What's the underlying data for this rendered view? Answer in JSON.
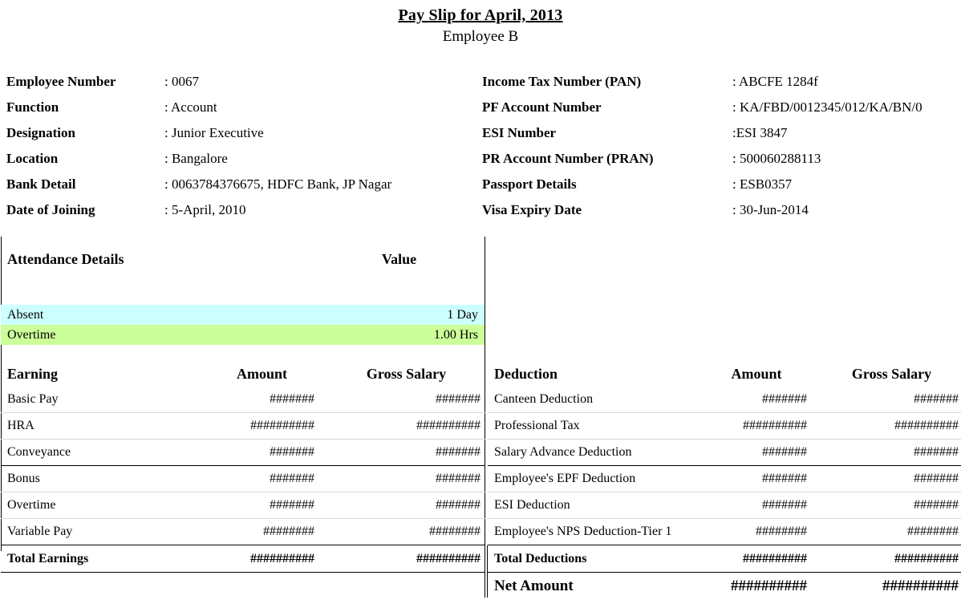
{
  "header": {
    "title": "Pay Slip for April, 2013",
    "subtitle": "Employee B"
  },
  "employee_info": {
    "left": [
      {
        "label": "Employee Number",
        "value": ": 0067"
      },
      {
        "label": "Function",
        "value": ": Account"
      },
      {
        "label": "Designation",
        "value": ": Junior Executive"
      },
      {
        "label": "Location",
        "value": ": Bangalore"
      },
      {
        "label": "Bank Detail",
        "value": ": 0063784376675, HDFC Bank, JP Nagar"
      },
      {
        "label": "Date of Joining",
        "value": ": 5-April, 2010"
      }
    ],
    "right": [
      {
        "label": "Income Tax Number (PAN)",
        "value": ": ABCFE 1284f"
      },
      {
        "label": "PF Account Number",
        "value": ": KA/FBD/0012345/012/KA/BN/0"
      },
      {
        "label": "ESI Number",
        "value": ":ESI 3847"
      },
      {
        "label": "PR Account Number (PRAN)",
        "value": ": 500060288113"
      },
      {
        "label": "Passport Details",
        "value": ": ESB0357"
      },
      {
        "label": "Visa Expiry Date",
        "value": ": 30-Jun-2014"
      }
    ]
  },
  "attendance": {
    "header": {
      "label": "Attendance Details",
      "value": "Value"
    },
    "rows": [
      {
        "label": "Absent",
        "value": "1 Day",
        "color": "#ccffff"
      },
      {
        "label": "Overtime",
        "value": "1.00 Hrs",
        "color": "#ccff99"
      }
    ]
  },
  "earnings": {
    "headers": {
      "c1": "Earning",
      "c2": "Amount",
      "c3": "Gross Salary"
    },
    "rows": [
      {
        "label": "Basic Pay",
        "amount": "#######",
        "gross": "#######"
      },
      {
        "label": "HRA",
        "amount": "##########",
        "gross": "##########"
      },
      {
        "label": "Conveyance",
        "amount": "#######",
        "gross": "#######"
      },
      {
        "label": "Bonus",
        "amount": "#######",
        "gross": "#######"
      },
      {
        "label": "Overtime",
        "amount": "#######",
        "gross": "#######"
      },
      {
        "label": "Variable Pay",
        "amount": "########",
        "gross": "########"
      }
    ],
    "total": {
      "label": "Total Earnings",
      "amount": "##########",
      "gross": "##########"
    }
  },
  "deductions": {
    "headers": {
      "c1": "Deduction",
      "c2": "Amount",
      "c3": "Gross Salary"
    },
    "rows": [
      {
        "label": "Canteen Deduction",
        "amount": "#######",
        "gross": "#######"
      },
      {
        "label": "Professional Tax",
        "amount": "##########",
        "gross": "##########"
      },
      {
        "label": "Salary Advance Deduction",
        "amount": "#######",
        "gross": "#######"
      },
      {
        "label": "Employee's EPF Deduction",
        "amount": "#######",
        "gross": "#######"
      },
      {
        "label": "ESI Deduction",
        "amount": "#######",
        "gross": "#######"
      },
      {
        "label": "Employee's NPS Deduction-Tier 1",
        "amount": "########",
        "gross": "########"
      }
    ],
    "total": {
      "label": "Total Deductions",
      "amount": "##########",
      "gross": "##########"
    },
    "net": {
      "label": "Net Amount",
      "amount": "##########",
      "gross": "##########"
    }
  },
  "colors": {
    "absent_row": "#ccffff",
    "overtime_row": "#ccff99",
    "border": "#000000",
    "light_border": "#d9d9d9"
  }
}
